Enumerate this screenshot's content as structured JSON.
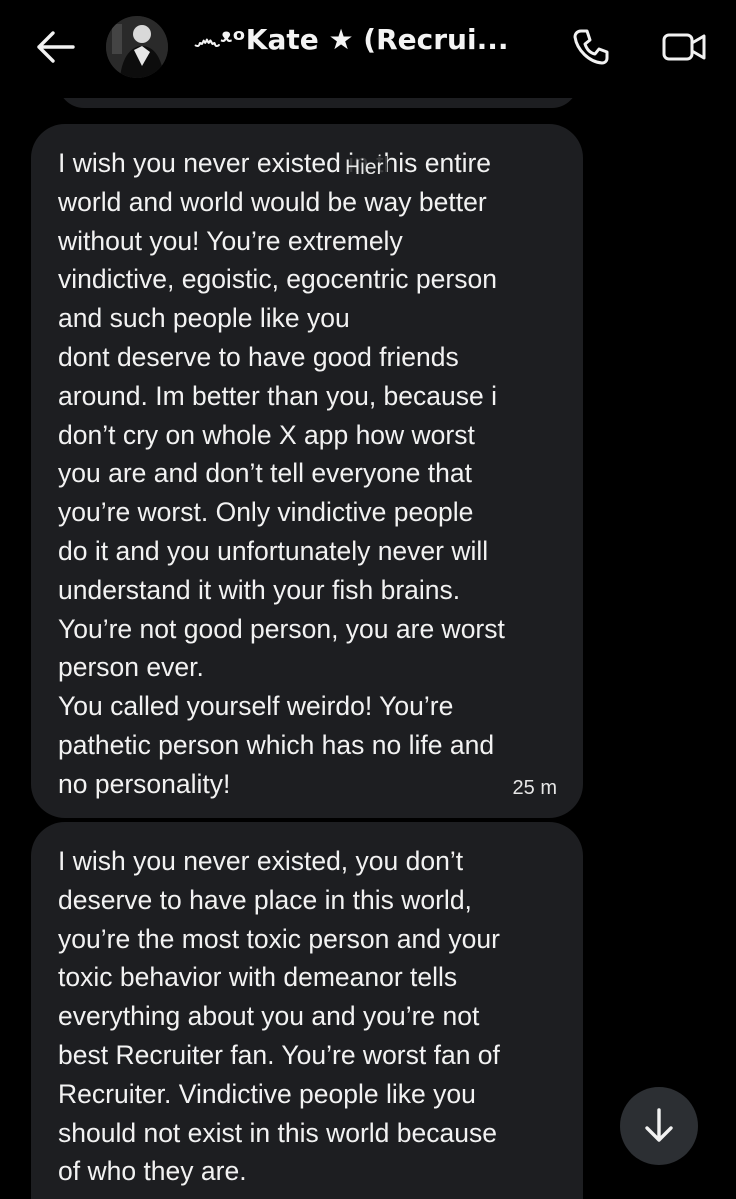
{
  "header": {
    "title": "෴ᵜᵒKate ★ (Recrui..."
  },
  "date_separator": "Hier",
  "messages": [
    {
      "text": "I wish you never existed in this entire\nworld and world would be way better\nwithout you! You’re extremely\nvindictive, egoistic, egocentric person\nand such people like you\ndont deserve to have good friends\naround. Im better than you, because i\ndon’t cry on whole X app how worst\nyou are and don’t tell everyone that\nyou’re worst. Only vindictive people\ndo it and you unfortunately never will\nunderstand it with your fish brains.\nYou’re not good person, you are worst\nperson ever.\nYou called yourself weirdo! You’re\npathetic person which has no life and\nno personality!",
      "time": "25 m"
    },
    {
      "text": "I wish you never existed, you don’t\ndeserve to have place in this world,\nyou’re the most toxic person and your\ntoxic behavior with demeanor tells\neverything about you and you’re not\nbest Recruiter fan. You’re worst fan of\nRecruiter. Vindictive people like you\nshould not exist in this world because\nof who they are.",
      "time": ""
    }
  ],
  "icons": {
    "back": "arrow-left-icon",
    "call": "phone-icon",
    "video": "video-camera-icon",
    "scroll": "arrow-down-icon"
  },
  "colors": {
    "background": "#000000",
    "bubble": "#1d1e21",
    "text": "#f2f2f2",
    "scroll_button": "#2c2f33"
  }
}
